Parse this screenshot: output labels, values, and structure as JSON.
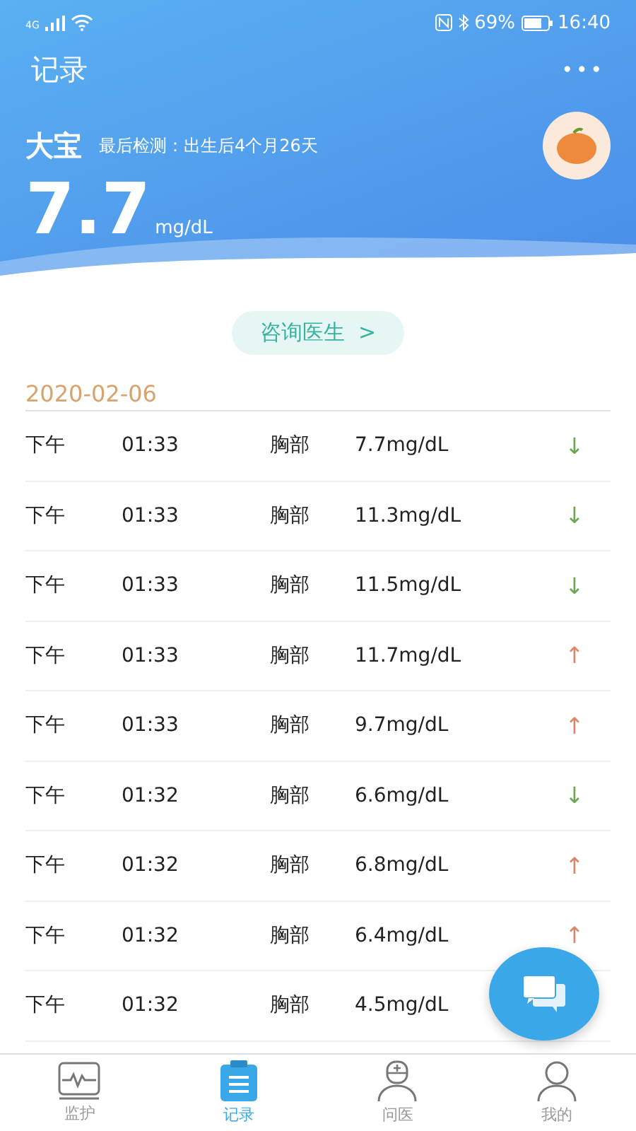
{
  "status_bar": {
    "network": "4G",
    "battery": "69%",
    "time": "16:40"
  },
  "header": {
    "title": "记录",
    "more": "•••",
    "name": "大宝",
    "last_check": "最后检测：出生后4个月26天",
    "value": "7.7",
    "unit": "mg/dL"
  },
  "consult_button": {
    "label": "咨询医生",
    "chevron": ">"
  },
  "date": "2020-02-06",
  "records": [
    {
      "period": "下午",
      "time": "01:33",
      "site": "胸部",
      "reading": "7.7mg/dL",
      "trend": "↓",
      "kind": "down"
    },
    {
      "period": "下午",
      "time": "01:33",
      "site": "胸部",
      "reading": "11.3mg/dL",
      "trend": "↓",
      "kind": "down"
    },
    {
      "period": "下午",
      "time": "01:33",
      "site": "胸部",
      "reading": "11.5mg/dL",
      "trend": "↓",
      "kind": "down"
    },
    {
      "period": "下午",
      "time": "01:33",
      "site": "胸部",
      "reading": "11.7mg/dL",
      "trend": "↑",
      "kind": "up"
    },
    {
      "period": "下午",
      "time": "01:33",
      "site": "胸部",
      "reading": "9.7mg/dL",
      "trend": "↑",
      "kind": "up"
    },
    {
      "period": "下午",
      "time": "01:32",
      "site": "胸部",
      "reading": "6.6mg/dL",
      "trend": "↓",
      "kind": "down"
    },
    {
      "period": "下午",
      "time": "01:32",
      "site": "胸部",
      "reading": "6.8mg/dL",
      "trend": "↑",
      "kind": "up"
    },
    {
      "period": "下午",
      "time": "01:32",
      "site": "胸部",
      "reading": "6.4mg/dL",
      "trend": "↑",
      "kind": "up"
    },
    {
      "period": "下午",
      "time": "01:32",
      "site": "胸部",
      "reading": "4.5mg/dL"
    }
  ],
  "tabs": [
    {
      "label": "监护",
      "kind": "monitor",
      "selected": false
    },
    {
      "label": "记录",
      "kind": "records",
      "selected": true
    },
    {
      "label": "问医",
      "kind": "doctor",
      "selected": false
    },
    {
      "label": "我的",
      "kind": "profile",
      "selected": false
    }
  ]
}
